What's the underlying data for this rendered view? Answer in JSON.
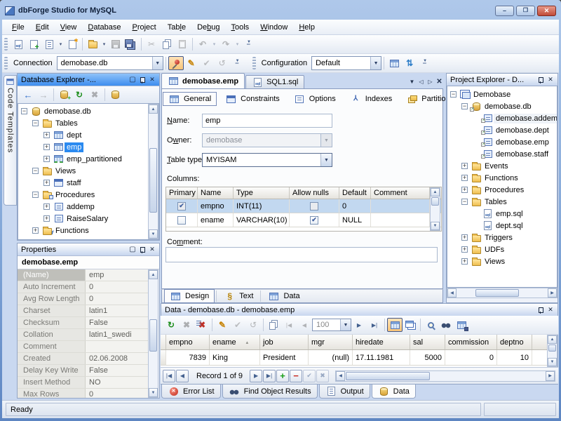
{
  "window": {
    "title": "dbForge Studio for MySQL"
  },
  "menu": {
    "items": [
      {
        "label": "File",
        "accel": 0
      },
      {
        "label": "Edit",
        "accel": 0
      },
      {
        "label": "View",
        "accel": 0
      },
      {
        "label": "Database",
        "accel": 0
      },
      {
        "label": "Project",
        "accel": 0
      },
      {
        "label": "Table",
        "accel": 3
      },
      {
        "label": "Debug",
        "accel": 2
      },
      {
        "label": "Tools",
        "accel": 0
      },
      {
        "label": "Window",
        "accel": 0
      },
      {
        "label": "Help",
        "accel": 0
      }
    ]
  },
  "toolbars": {
    "standard": [
      {
        "name": "new-sql-icon"
      },
      {
        "name": "new-object-icon"
      },
      {
        "name": "new-template-icon",
        "dropdown": true
      },
      {
        "name": "new-file-icon"
      },
      {
        "sep": true
      },
      {
        "name": "open-file-icon",
        "dropdown": true
      },
      {
        "name": "save-icon",
        "disabled": true
      },
      {
        "name": "save-all-icon"
      },
      {
        "sep": true
      },
      {
        "name": "cut-icon",
        "disabled": true
      },
      {
        "name": "copy-icon"
      },
      {
        "name": "paste-icon",
        "disabled": true
      },
      {
        "sep": true
      },
      {
        "name": "undo-icon",
        "disabled": true,
        "dropdown": true
      },
      {
        "name": "redo-icon",
        "disabled": true,
        "dropdown": true
      },
      {
        "name": "toolbar-overflow-icon"
      }
    ],
    "connection": {
      "label": "Connection",
      "value": "demobase.db",
      "buttons": [
        {
          "name": "pin-connection-icon",
          "selected": true
        },
        {
          "name": "edit-connection-icon"
        },
        {
          "name": "commit-icon",
          "disabled": true
        },
        {
          "name": "rollback-icon",
          "disabled": true
        },
        {
          "name": "toolbar-overflow-icon"
        }
      ]
    },
    "configuration": {
      "label": "Configuration",
      "value": "Default",
      "buttons": [
        {
          "name": "configuration-properties-icon"
        },
        {
          "name": "synchronize-icon"
        },
        {
          "name": "toolbar-overflow-icon"
        }
      ]
    }
  },
  "code_templates": {
    "label": "Code Templates"
  },
  "database_explorer": {
    "title": "Database Explorer -...",
    "toolbar": [
      {
        "name": "back-icon"
      },
      {
        "name": "forward-icon",
        "disabled": true
      },
      {
        "sep": true
      },
      {
        "name": "new-connection-icon"
      },
      {
        "name": "refresh-icon"
      },
      {
        "name": "delete-icon",
        "disabled": true
      },
      {
        "sep": true
      },
      {
        "name": "copy-database-icon"
      }
    ],
    "tree": [
      {
        "label": "demobase.db",
        "level": 0,
        "expand": "minus",
        "icon": "database-icon"
      },
      {
        "label": "Tables",
        "level": 1,
        "expand": "minus",
        "icon": "folder-icon"
      },
      {
        "label": "dept",
        "level": 2,
        "expand": "plus",
        "icon": "table-icon"
      },
      {
        "label": "emp",
        "level": 2,
        "expand": "plus",
        "icon": "table-icon",
        "selected": true
      },
      {
        "label": "emp_partitioned",
        "level": 2,
        "expand": "plus",
        "icon": "partitioned-table-icon"
      },
      {
        "label": "Views",
        "level": 1,
        "expand": "minus",
        "icon": "folder-icon"
      },
      {
        "label": "staff",
        "level": 2,
        "expand": "plus",
        "icon": "view-icon"
      },
      {
        "label": "Procedures",
        "level": 1,
        "expand": "minus",
        "icon": "procedures-folder-icon"
      },
      {
        "label": "addemp",
        "level": 2,
        "expand": "plus",
        "icon": "procedure-icon"
      },
      {
        "label": "RaiseSalary",
        "level": 2,
        "expand": "plus",
        "icon": "procedure-icon"
      },
      {
        "label": "Functions",
        "level": 1,
        "expand": "plus",
        "icon": "functions-folder-icon"
      }
    ]
  },
  "properties": {
    "title": "Properties",
    "object": "demobase.emp",
    "rows": [
      {
        "name": "(Name)",
        "value": "emp"
      },
      {
        "name": "Auto Increment",
        "value": "0"
      },
      {
        "name": "Avg Row Length",
        "value": "0"
      },
      {
        "name": "Charset",
        "value": "latin1"
      },
      {
        "name": "Checksum",
        "value": "False"
      },
      {
        "name": "Collation",
        "value": "latin1_swedi"
      },
      {
        "name": "Comment",
        "value": ""
      },
      {
        "name": "Created",
        "value": "02.06.2008"
      },
      {
        "name": "Delay Key Write",
        "value": "False"
      },
      {
        "name": "Insert Method",
        "value": "NO"
      },
      {
        "name": "Max Rows",
        "value": "0"
      }
    ]
  },
  "document": {
    "tabs": [
      {
        "label": "demobase.emp",
        "icon": "table-icon",
        "active": true
      },
      {
        "label": "SQL1.sql",
        "icon": "sql-file-icon",
        "active": false
      }
    ],
    "subtabs": [
      {
        "label": "General",
        "icon": "general-icon",
        "active": true
      },
      {
        "label": "Constraints",
        "icon": "constraints-icon"
      },
      {
        "label": "Options",
        "icon": "options-icon"
      },
      {
        "label": "Indexes",
        "icon": "indexes-icon"
      },
      {
        "label": "Partitioning",
        "icon": "partitioning-icon"
      }
    ],
    "form": {
      "name_label": {
        "label": "Name:",
        "accel": 0
      },
      "name_value": "emp",
      "owner_label": {
        "label": "Owner:",
        "accel": 1
      },
      "owner_value": "demobase",
      "type_label": {
        "label": "Table type:",
        "accel": 0
      },
      "type_value": "MYISAM",
      "columns_label": {
        "label": "Columns:",
        "accel": -1
      },
      "comment_label": {
        "label": "Comment:",
        "accel": 2
      },
      "comment_value": ""
    },
    "columns_grid": {
      "headers": [
        "Primary",
        "Name",
        "Type",
        "Allow nulls",
        "Default",
        "Comment"
      ],
      "rows": [
        {
          "primary": true,
          "name": "empno",
          "type": "INT(11)",
          "allow_nulls": false,
          "default": "0",
          "comment": "",
          "selected": true
        },
        {
          "primary": false,
          "name": "ename",
          "type": "VARCHAR(10)",
          "allow_nulls": true,
          "default": "NULL",
          "comment": "",
          "selected": false
        }
      ]
    },
    "bottom_tabs": [
      {
        "label": "Design",
        "icon": "design-icon",
        "active": true
      },
      {
        "label": "Text",
        "icon": "text-icon"
      },
      {
        "label": "Data",
        "icon": "data-icon"
      }
    ]
  },
  "project_explorer": {
    "title": "Project Explorer - D...",
    "tree": [
      {
        "label": "Demobase",
        "level": 0,
        "expand": "minus",
        "icon": "project-icon"
      },
      {
        "label": "demobase.db",
        "level": 1,
        "expand": "minus",
        "icon": "project-database-icon"
      },
      {
        "label": "demobase.addemp",
        "level": 2,
        "expand": null,
        "icon": "shortcut-object-icon",
        "hot": true
      },
      {
        "label": "demobase.dept",
        "level": 2,
        "expand": null,
        "icon": "shortcut-object-icon"
      },
      {
        "label": "demobase.emp",
        "level": 2,
        "expand": null,
        "icon": "shortcut-object-icon"
      },
      {
        "label": "demobase.staff",
        "level": 2,
        "expand": null,
        "icon": "shortcut-object-icon"
      },
      {
        "label": "Events",
        "level": 1,
        "expand": "plus",
        "icon": "folder-icon"
      },
      {
        "label": "Functions",
        "level": 1,
        "expand": "plus",
        "icon": "folder-icon"
      },
      {
        "label": "Procedures",
        "level": 1,
        "expand": "plus",
        "icon": "folder-icon"
      },
      {
        "label": "Tables",
        "level": 1,
        "expand": "minus",
        "icon": "folder-icon"
      },
      {
        "label": "emp.sql",
        "level": 2,
        "expand": null,
        "icon": "sql-file-icon"
      },
      {
        "label": "dept.sql",
        "level": 2,
        "expand": null,
        "icon": "sql-file-icon"
      },
      {
        "label": "Triggers",
        "level": 1,
        "expand": "plus",
        "icon": "folder-icon"
      },
      {
        "label": "UDFs",
        "level": 1,
        "expand": "plus",
        "icon": "folder-icon"
      },
      {
        "label": "Views",
        "level": 1,
        "expand": "plus",
        "icon": "folder-icon"
      }
    ]
  },
  "data_panel": {
    "title": "Data - demobase.db - demobase.emp",
    "toolbar": [
      {
        "name": "refresh-data-icon"
      },
      {
        "name": "delete-data-icon",
        "disabled": true
      },
      {
        "name": "remove-filter-icon"
      },
      {
        "sep": true
      },
      {
        "name": "edit-record-pencil-icon"
      },
      {
        "name": "post-edit-icon",
        "disabled": true
      },
      {
        "name": "cancel-edit-icon",
        "disabled": true
      },
      {
        "sep": true
      },
      {
        "name": "copy-data-icon"
      },
      {
        "name": "first-page-icon",
        "disabled": true
      },
      {
        "name": "prev-page-icon",
        "disabled": true
      },
      {
        "combo": true,
        "name": "page-size-combo",
        "value": "100"
      },
      {
        "name": "next-page-icon"
      },
      {
        "name": "last-page-icon"
      },
      {
        "sep": true
      },
      {
        "name": "grid-view-icon",
        "selected": true
      },
      {
        "name": "card-view-icon"
      },
      {
        "sep": true
      },
      {
        "name": "quick-filter-icon"
      },
      {
        "name": "find-data-icon"
      },
      {
        "name": "export-data-icon"
      }
    ],
    "grid": {
      "headers": [
        "empno",
        "ename",
        "job",
        "mgr",
        "hiredate",
        "sal",
        "commission",
        "deptno"
      ],
      "sort_column": "ename",
      "aligns": [
        "right",
        "left",
        "left",
        "right",
        "left",
        "right",
        "right",
        "right"
      ],
      "rows": [
        [
          "7839",
          "King",
          "President",
          "(null)",
          "17.11.1981",
          "5000",
          "0",
          "10"
        ]
      ]
    },
    "record_label": "Record 1 of 9"
  },
  "dock_tabs": [
    {
      "label": "Error List",
      "icon": "error-list-icon"
    },
    {
      "label": "Find Object Results",
      "icon": "find-results-icon"
    },
    {
      "label": "Output",
      "icon": "output-icon"
    },
    {
      "label": "Data",
      "icon": "data-tab-icon",
      "active": true
    }
  ],
  "statusbar": {
    "text": "Ready"
  }
}
